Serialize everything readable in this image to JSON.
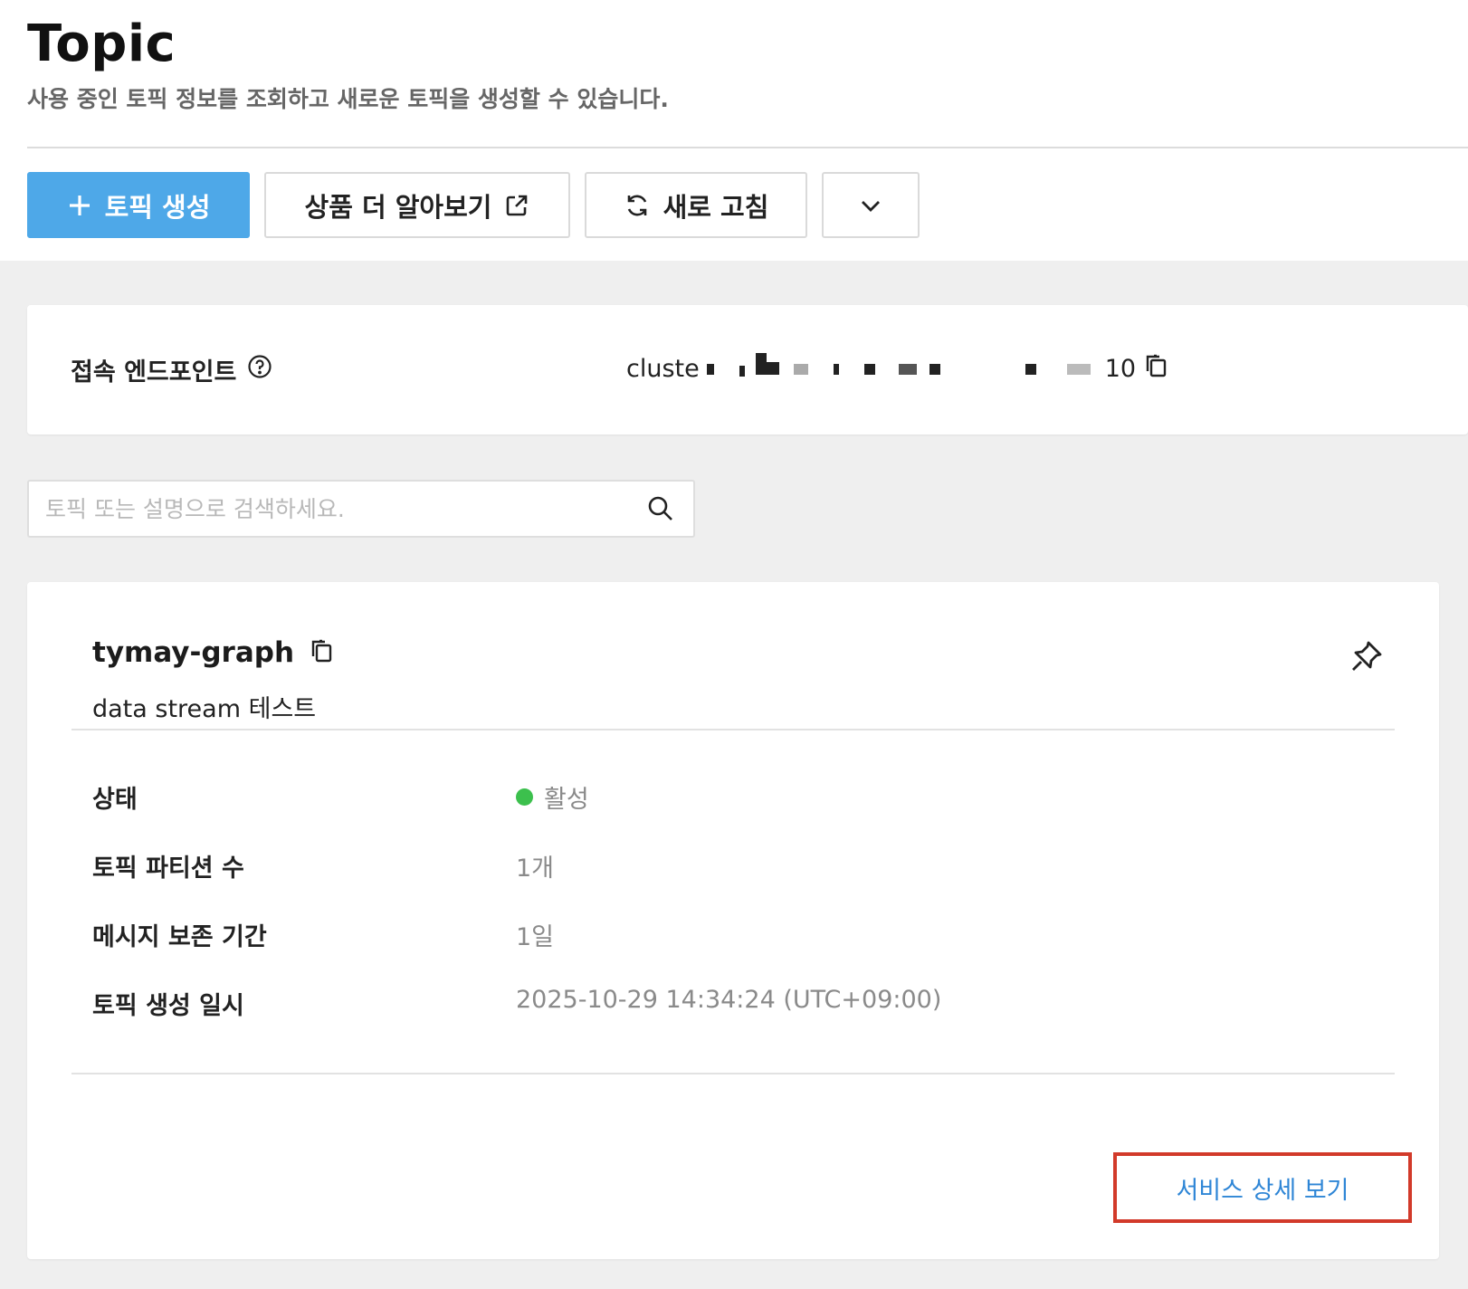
{
  "header": {
    "title": "Topic",
    "subtitle": "사용 중인 토픽 정보를 조회하고 새로운 토픽을 생성할 수 있습니다."
  },
  "toolbar": {
    "create_label": "토픽 생성",
    "learn_more_label": "상품 더 알아보기",
    "refresh_label": "새로 고침"
  },
  "endpoint": {
    "label": "접속 엔드포인트",
    "value_prefix": "cluste",
    "value_suffix": "10"
  },
  "search": {
    "placeholder": "토픽 또는 설명으로 검색하세요.",
    "value": ""
  },
  "topic": {
    "name": "tymay-graph",
    "description": "data stream 테스트",
    "fields": [
      {
        "label": "상태",
        "value": "활성"
      },
      {
        "label": "토픽 파티션 수",
        "value": "1개"
      },
      {
        "label": "메시지 보존 기간",
        "value": "1일"
      },
      {
        "label": "토픽 생성 일시",
        "value": "2025-10-29 14:34:24 (UTC+09:00)"
      }
    ],
    "detail_link": "서비스 상세 보기"
  },
  "colors": {
    "primary": "#4ea8e8",
    "status_active": "#3cc04d",
    "link": "#2f86d6",
    "highlight_border": "#d23a2a"
  },
  "icons": [
    "plus-icon",
    "external-link-icon",
    "refresh-icon",
    "chevron-down-icon",
    "help-icon",
    "copy-icon",
    "search-icon",
    "pin-icon"
  ]
}
